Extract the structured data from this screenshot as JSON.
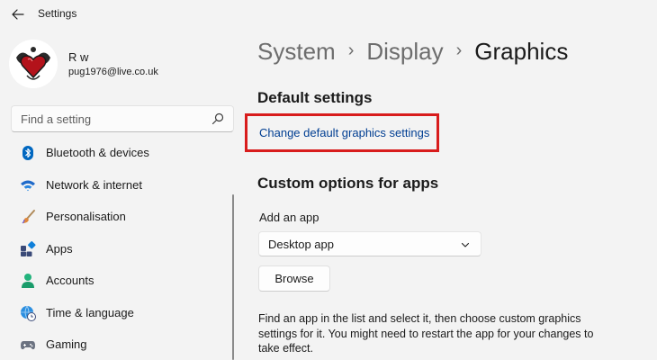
{
  "window": {
    "title": "Settings"
  },
  "profile": {
    "name": "R w",
    "email": "pug1976@live.co.uk"
  },
  "search": {
    "placeholder": "Find a setting"
  },
  "sidebar": {
    "items": [
      {
        "label": "Bluetooth & devices",
        "icon": "bluetooth-icon"
      },
      {
        "label": "Network & internet",
        "icon": "wifi-icon"
      },
      {
        "label": "Personalisation",
        "icon": "brush-icon"
      },
      {
        "label": "Apps",
        "icon": "apps-icon"
      },
      {
        "label": "Accounts",
        "icon": "person-icon"
      },
      {
        "label": "Time & language",
        "icon": "globe-clock-icon"
      },
      {
        "label": "Gaming",
        "icon": "gamepad-icon"
      }
    ]
  },
  "breadcrumb": {
    "items": [
      "System",
      "Display",
      "Graphics"
    ],
    "separator": "›"
  },
  "default_settings": {
    "heading": "Default settings",
    "link": "Change default graphics settings"
  },
  "custom_options": {
    "heading": "Custom options for apps",
    "add_label": "Add an app",
    "dropdown_value": "Desktop app",
    "browse_label": "Browse",
    "description": "Find an app in the list and select it, then choose custom graphics settings for it. You might need to restart the app for your changes to take effect."
  },
  "colors": {
    "background": "#f3f3f3",
    "link": "#003e92",
    "highlight": "#d81c1c",
    "accent_blue": "#0067c0"
  }
}
